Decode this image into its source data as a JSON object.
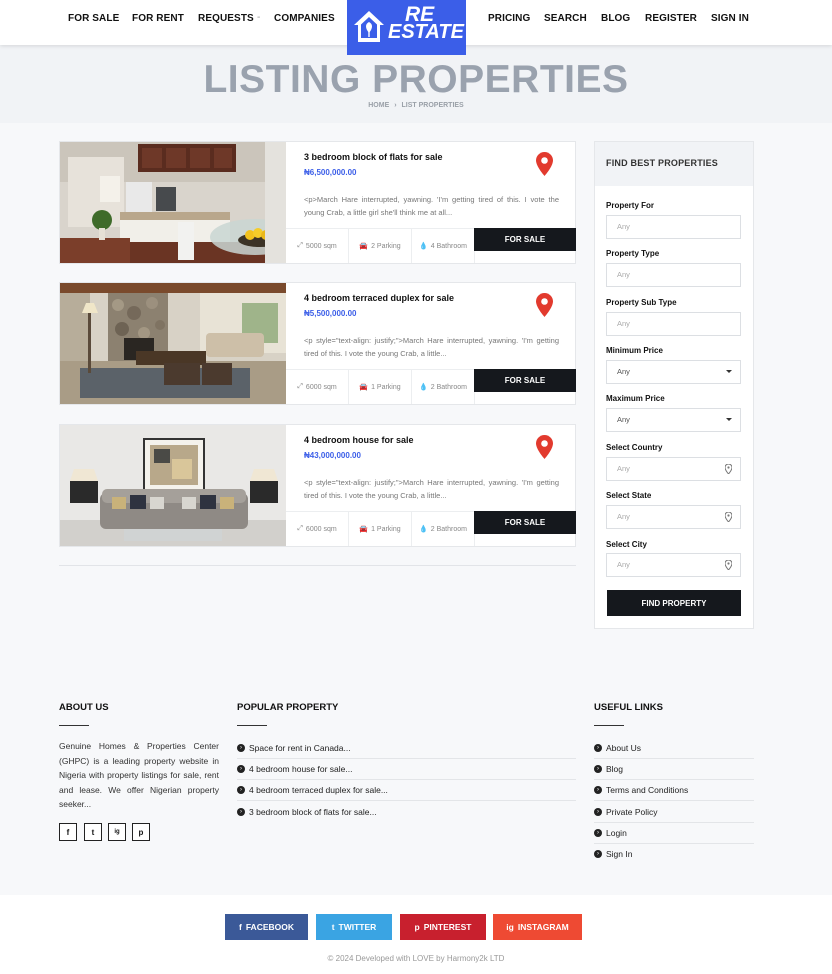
{
  "nav": {
    "left": [
      "FOR SALE",
      "FOR RENT",
      "REQUESTS",
      "COMPANIES"
    ],
    "separator": "-",
    "right": [
      "PRICING",
      "SEARCH",
      "BLOG",
      "REGISTER",
      "SIGN IN"
    ]
  },
  "logo": {
    "line1": "RE",
    "line2": "ESTATE"
  },
  "hero": {
    "title": "LISTING PROPERTIES",
    "breadcrumb_home": "HOME",
    "breadcrumb_sep": "›",
    "breadcrumb_current": "LIST PROPERTIES"
  },
  "listings": [
    {
      "title": "3 bedroom block of flats for sale",
      "price": "₦6,500,000.00",
      "description": "<p>March Hare interrupted, yawning. 'I'm getting tired of this. I vote the young Crab, a little girl she'll think me at all...",
      "area": "5000 sqm",
      "parking": "2 Parking",
      "bathroom": "4 Bathroom",
      "status": "FOR SALE"
    },
    {
      "title": "4 bedroom terraced duplex for sale",
      "price": "₦5,500,000.00",
      "description": "<p style=\"text-align: justify;\">March Hare interrupted, yawning. 'I'm getting tired of this. I vote the young Crab, a little...",
      "area": "6000 sqm",
      "parking": "1 Parking",
      "bathroom": "2 Bathroom",
      "status": "FOR SALE"
    },
    {
      "title": "4 bedroom house for sale",
      "price": "₦43,000,000.00",
      "description": "<p style=\"text-align: justify;\">March Hare interrupted, yawning. 'I'm getting tired of this. I vote the young Crab, a little...",
      "area": "6000 sqm",
      "parking": "1 Parking",
      "bathroom": "2 Bathroom",
      "status": "FOR SALE"
    }
  ],
  "sidebar": {
    "title": "FIND BEST PROPERTIES",
    "fields": [
      {
        "label": "Property For",
        "value": "Any"
      },
      {
        "label": "Property Type",
        "value": "Any"
      },
      {
        "label": "Property Sub Type",
        "value": "Any"
      },
      {
        "label": "Minimum Price",
        "value": "Any"
      },
      {
        "label": "Maximum Price",
        "value": "Any"
      },
      {
        "label": "Select Country",
        "value": "Any"
      },
      {
        "label": "Select State",
        "value": "Any"
      },
      {
        "label": "Select City",
        "value": "Any"
      }
    ],
    "button": "FIND PROPERTY"
  },
  "footer": {
    "about_title": "ABOUT US",
    "about_text": "Genuine Homes & Properties Center (GHPC) is a leading property website in Nigeria with property listings for sale, rent and lease. We offer Nigerian property seeker...",
    "social_icons": [
      "f",
      "t",
      "ig",
      "p"
    ],
    "popular_title": "POPULAR PROPERTY",
    "popular": [
      "Space for rent in Canada...",
      "4 bedroom house for sale...",
      "4 bedroom terraced duplex for sale...",
      "3 bedroom block of flats for sale..."
    ],
    "links_title": "USEFUL LINKS",
    "links": [
      "About Us",
      "Blog",
      "Terms and Conditions",
      "Private Policy",
      "Login",
      "Sign In"
    ]
  },
  "share": [
    {
      "label": "FACEBOOK",
      "icon": "f",
      "color": "#3b5998"
    },
    {
      "label": "TWITTER",
      "icon": "t",
      "color": "#3aa4e3"
    },
    {
      "label": "PINTEREST",
      "icon": "p",
      "color": "#c8202e"
    },
    {
      "label": "INSTAGRAM",
      "icon": "ig",
      "color": "#ee4a33"
    }
  ],
  "copyright": "© 2024 Developed with LOVE by Harmony2k LTD"
}
